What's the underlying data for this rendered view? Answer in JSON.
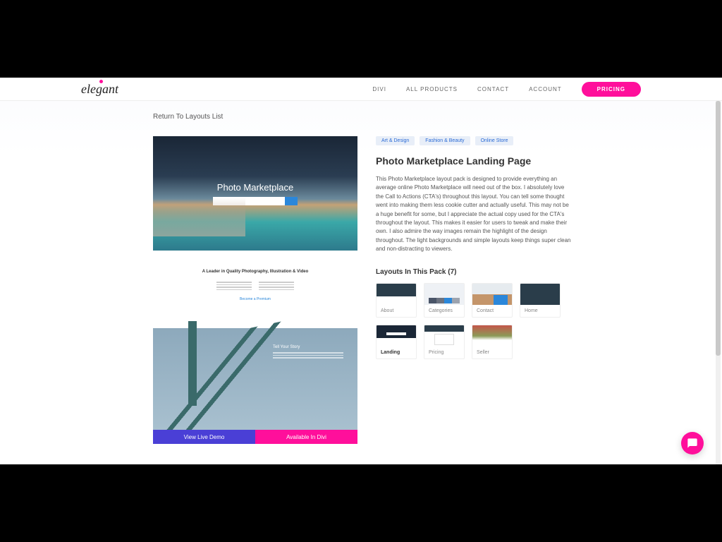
{
  "nav": {
    "logo": "elegant",
    "links": [
      "DIVI",
      "ALL PRODUCTS",
      "CONTACT",
      "ACCOUNT"
    ],
    "pricing": "PRICING"
  },
  "return_link": "Return To Layouts List",
  "preview": {
    "hero_title": "Photo Marketplace",
    "section_title": "A Leader in Quality Photography, Illustration & Video",
    "section_link": "Become a Premium"
  },
  "actions": {
    "live_demo": "View Live Demo",
    "available": "Available In Divi"
  },
  "tags": [
    "Art & Design",
    "Fashion & Beauty",
    "Online Store"
  ],
  "title": "Photo Marketplace Landing Page",
  "description": "This Photo Marketplace layout pack is designed to provide everything an average online Photo Marketplace will need out of the box. I absolutely love the Call to Actions (CTA's) throughout this layout. You can tell some thought went into making them less cookie cutter and actually useful. This may not be a huge benefit for some, but I appreciate the actual copy used for the CTA's throughout the layout. This makes it easier for users to tweak and make their own. I also admire the way images remain the highlight of the design throughout. The light backgrounds and simple layouts keep things super clean and non-distracting to viewers.",
  "layouts_heading": "Layouts In This Pack (7)",
  "layouts": [
    {
      "label": "About",
      "thumb": "about",
      "active": false
    },
    {
      "label": "Categories",
      "thumb": "cat",
      "active": false
    },
    {
      "label": "Contact",
      "thumb": "contact",
      "active": false
    },
    {
      "label": "Home",
      "thumb": "home",
      "active": false
    },
    {
      "label": "Landing",
      "thumb": "landing",
      "active": true
    },
    {
      "label": "Pricing",
      "thumb": "pricing",
      "active": false
    },
    {
      "label": "Seller",
      "thumb": "seller",
      "active": false
    }
  ]
}
